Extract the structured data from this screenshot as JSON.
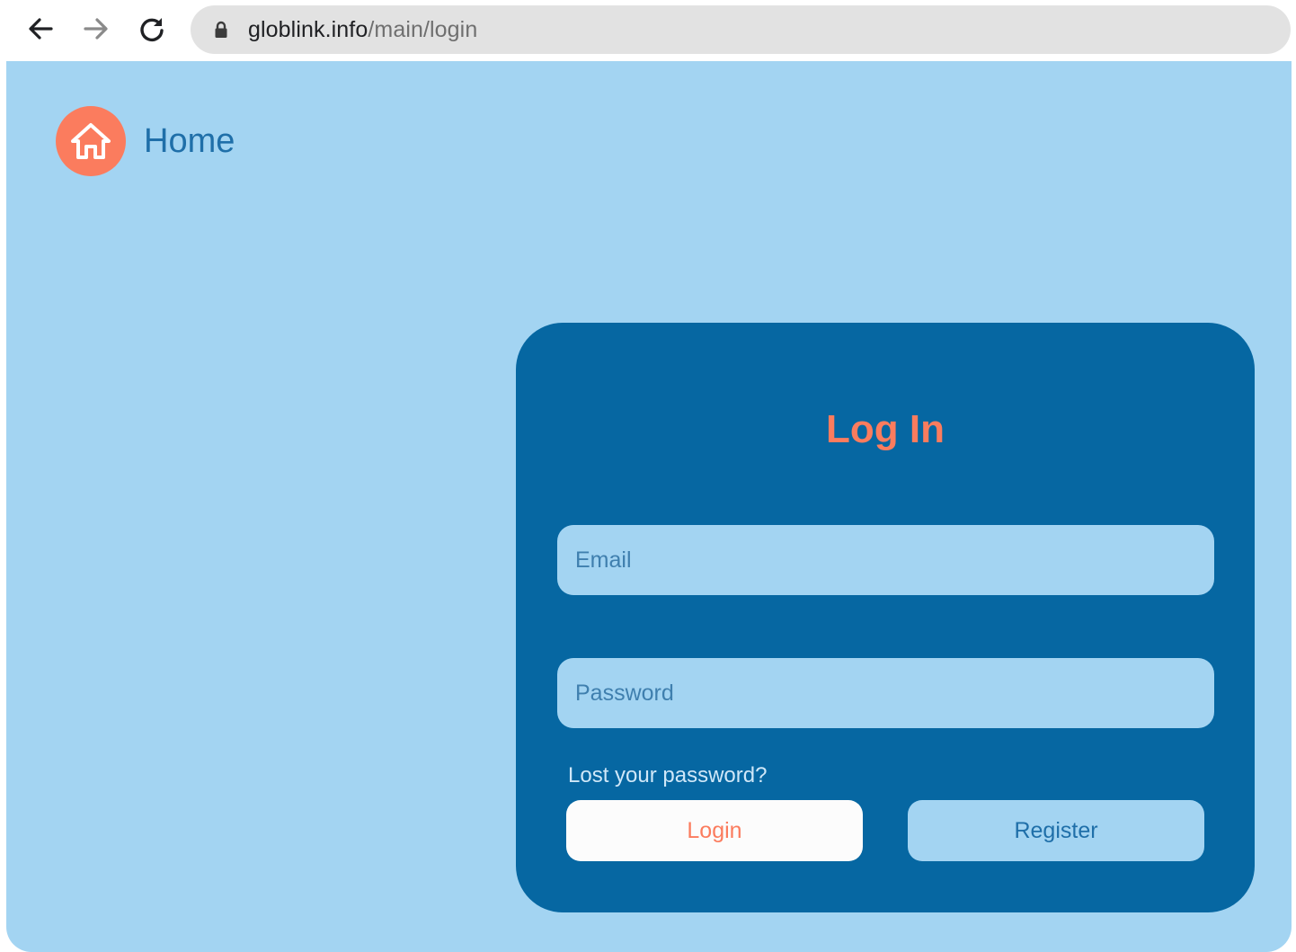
{
  "browser": {
    "url_host": "globlink.info",
    "url_path": "/main/login",
    "icons": {
      "back": "arrow-left-icon",
      "forward": "arrow-right-icon",
      "reload": "reload-icon",
      "lock": "lock-icon"
    }
  },
  "header": {
    "home_label": "Home",
    "home_icon": "house-icon"
  },
  "login": {
    "title": "Log In",
    "email_placeholder": "Email",
    "password_placeholder": "Password",
    "lost_password": "Lost your password?",
    "login_button": "Login",
    "register_button": "Register"
  },
  "colors": {
    "page_background": "#a3d4f2",
    "card_background": "#0667a2",
    "accent": "#fb7c5e",
    "text_blue": "#1f6fa9"
  }
}
